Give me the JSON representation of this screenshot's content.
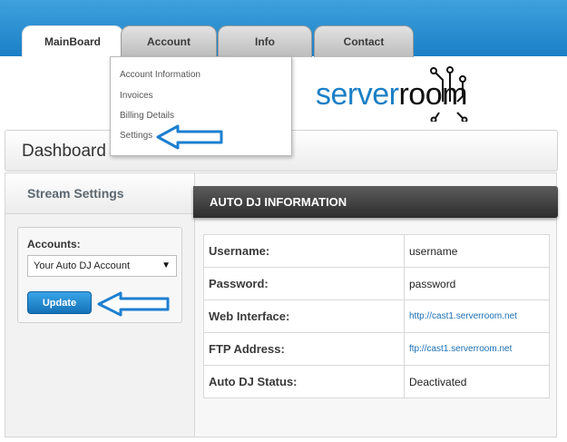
{
  "tabs": [
    {
      "label": "MainBoard",
      "active": true
    },
    {
      "label": "Account",
      "active": false
    },
    {
      "label": "Info",
      "active": false
    },
    {
      "label": "Contact",
      "active": false
    }
  ],
  "account_menu": {
    "items": [
      "Account Information",
      "Invoices",
      "Billing Details",
      "Settings"
    ]
  },
  "logo": {
    "part1": "server",
    "part2": "room"
  },
  "dashboard": {
    "title": "Dashboard"
  },
  "stream_settings": {
    "title": "Stream Settings",
    "accounts_label": "Accounts:",
    "selected_account": "Your Auto DJ Account",
    "update_label": "Update"
  },
  "autodj": {
    "title": "AUTO DJ INFORMATION",
    "rows": [
      {
        "key": "Username:",
        "value": "username"
      },
      {
        "key": "Password:",
        "value": "password"
      },
      {
        "key": "Web Interface:",
        "value": "http://cast1.serverroom.net"
      },
      {
        "key": "FTP Address:",
        "value": "ftp://cast1.serverroom.net"
      },
      {
        "key": "Auto DJ Status:",
        "value": "Deactivated"
      }
    ]
  },
  "colors": {
    "brand_blue": "#1a7fc6",
    "annotation_arrow": "#1d7fd0",
    "header_dark": "#2d2d2d"
  }
}
